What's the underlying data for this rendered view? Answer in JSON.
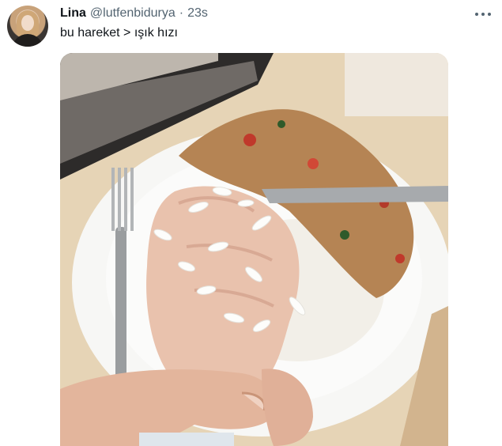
{
  "tweet": {
    "display_name": "Lina",
    "handle": "@lutfenbidurya",
    "separator": "·",
    "time": "23s",
    "text": "bu hareket > ışık hızı"
  },
  "icons": {
    "more": "more-horizontal-icon",
    "avatar": "avatar"
  },
  "colors": {
    "name": "#0f1419",
    "secondary": "#536471",
    "background": "#ffffff"
  }
}
